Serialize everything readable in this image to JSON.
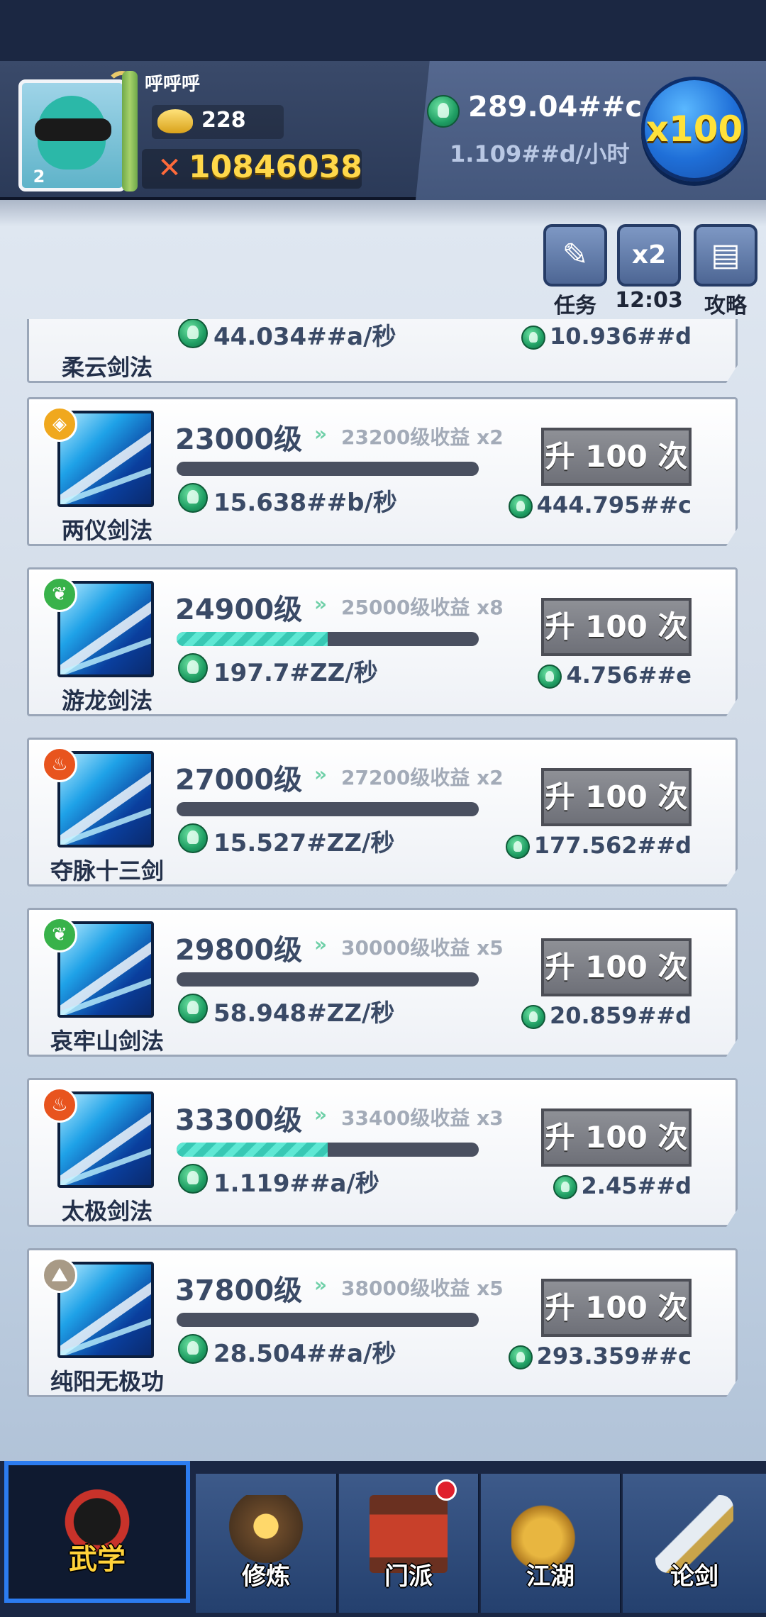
{
  "player": {
    "name": "呼呼呼",
    "avatar_level": "2",
    "gold": "228",
    "power": "10846038"
  },
  "currency": {
    "total": "289.04##c",
    "rate": "1.109##d/小时",
    "multiplier_label": "x100"
  },
  "tools": [
    {
      "label": "任务",
      "icon": "scroll-quest-icon",
      "text": ""
    },
    {
      "label": "12:03",
      "icon": "double-boost-icon",
      "text": "x2"
    },
    {
      "label": "攻略",
      "icon": "guide-scroll-icon",
      "text": ""
    }
  ],
  "partial_card": {
    "name": "柔云剑法",
    "rate": "44.034##a/秒",
    "cost": "10.936##d"
  },
  "skills": [
    {
      "name": "两仪剑法",
      "level": "23000级",
      "next": "23200级收益 x2",
      "progress": 0,
      "rate": "15.638##b/秒",
      "button": "升 100 次",
      "cost": "444.795##c",
      "element": "earth",
      "badge_color": "#f0a81e",
      "badge_icon": "◈"
    },
    {
      "name": "游龙剑法",
      "level": "24900级",
      "next": "25000级收益 x8",
      "progress": 0.5,
      "rate": "197.7#ZZ/秒",
      "button": "升 100 次",
      "cost": "4.756##e",
      "element": "wood",
      "badge_color": "#38b24a",
      "badge_icon": "❦"
    },
    {
      "name": "夺脉十三剑",
      "level": "27000级",
      "next": "27200级收益 x2",
      "progress": 0,
      "rate": "15.527#ZZ/秒",
      "button": "升 100 次",
      "cost": "177.562##d",
      "element": "fire",
      "badge_color": "#e8541e",
      "badge_icon": "♨"
    },
    {
      "name": "哀牢山剑法",
      "level": "29800级",
      "next": "30000级收益 x5",
      "progress": 0,
      "rate": "58.948#ZZ/秒",
      "button": "升 100 次",
      "cost": "20.859##d",
      "element": "wood",
      "badge_color": "#38b24a",
      "badge_icon": "❦"
    },
    {
      "name": "太极剑法",
      "level": "33300级",
      "next": "33400级收益 x3",
      "progress": 0.5,
      "rate": "1.119##a/秒",
      "button": "升 100 次",
      "cost": "2.45##d",
      "element": "fire",
      "badge_color": "#e8541e",
      "badge_icon": "♨"
    },
    {
      "name": "纯阳无极功",
      "level": "37800级",
      "next": "38000级收益 x5",
      "progress": 0,
      "rate": "28.504##a/秒",
      "button": "升 100 次",
      "cost": "293.359##c",
      "element": "earth",
      "badge_color": "#a89a86",
      "badge_icon": "⛰"
    }
  ],
  "nav": [
    {
      "label": "武学",
      "icon": "ninja-icon",
      "active": true
    },
    {
      "label": "修炼",
      "icon": "meditation-icon",
      "active": false
    },
    {
      "label": "门派",
      "icon": "temple-icon",
      "active": false,
      "badge": true
    },
    {
      "label": "江湖",
      "icon": "gourd-icon",
      "active": false
    },
    {
      "label": "论剑",
      "icon": "sword-icon",
      "active": false
    }
  ],
  "colors": {
    "accent_gold": "#ffd84a",
    "currency_green": "#1f9e63",
    "nav_active_border": "#2c7cf0",
    "progress_fill": "#5fe8d4"
  }
}
